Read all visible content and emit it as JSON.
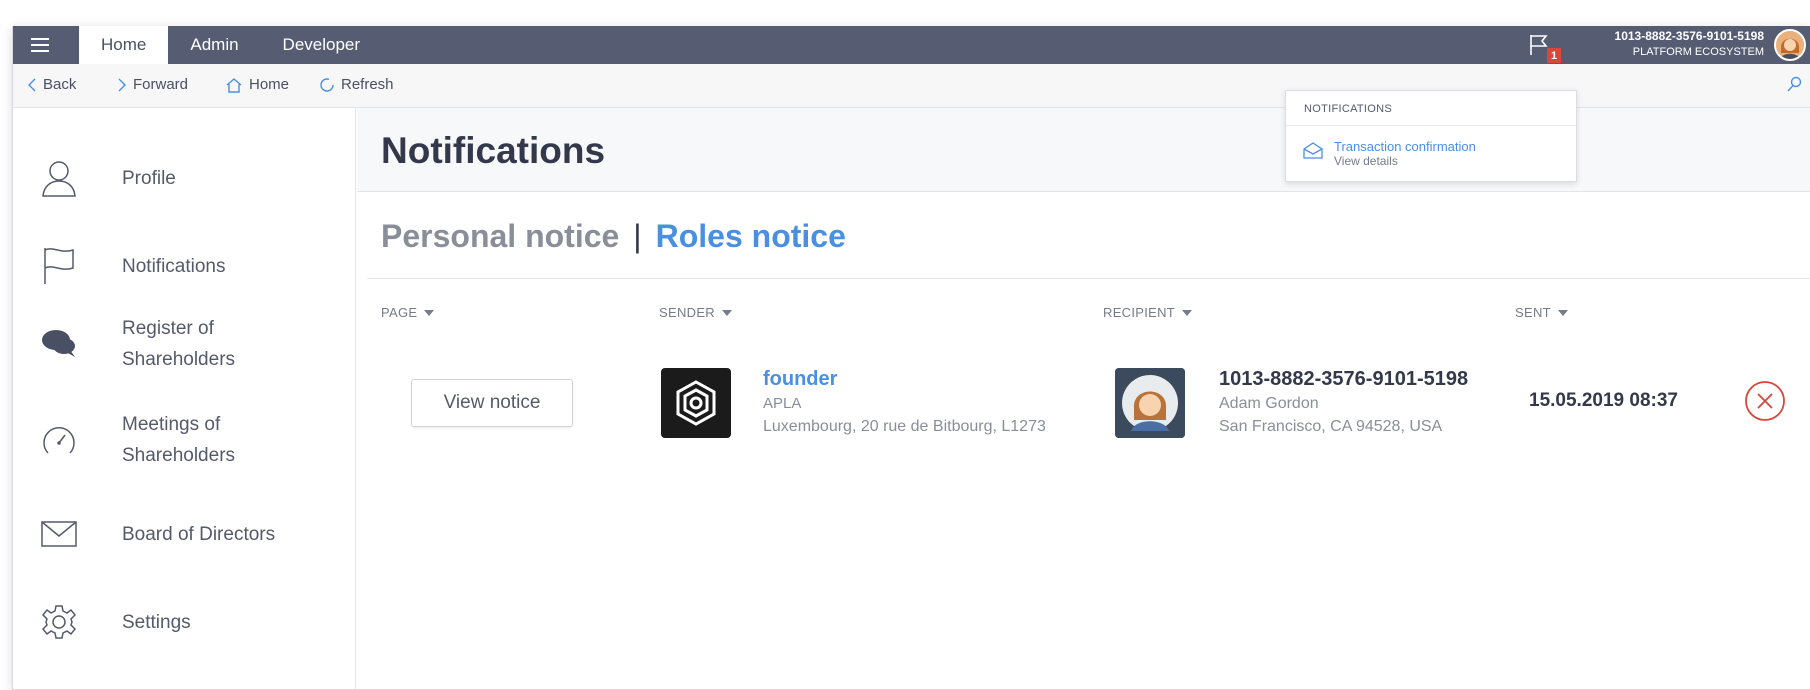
{
  "topbar": {
    "tabs": [
      "Home",
      "Admin",
      "Developer"
    ],
    "notification_count": "1",
    "account_id": "1013-8882-3576-9101-5198",
    "ecosystem": "PLATFORM ECOSYSTEM"
  },
  "navbar": {
    "back": "Back",
    "forward": "Forward",
    "home": "Home",
    "refresh": "Refresh"
  },
  "sidebar": {
    "items": [
      {
        "label": "Profile",
        "icon": "user-icon"
      },
      {
        "label": "Notifications",
        "icon": "flag-icon"
      },
      {
        "label": "Register of Shareholders",
        "icon": "chat-icon"
      },
      {
        "label": "Meetings of Shareholders",
        "icon": "gauge-icon"
      },
      {
        "label": "Board of Directors",
        "icon": "envelope-icon"
      },
      {
        "label": "Settings",
        "icon": "gear-icon"
      }
    ]
  },
  "main": {
    "title": "Notifications",
    "subtab_personal": "Personal notice",
    "subtab_separator": "|",
    "subtab_roles": "Roles notice",
    "columns": {
      "page": "PAGE",
      "sender": "SENDER",
      "recipient": "RECIPIENT",
      "sent": "SENT"
    },
    "row": {
      "view_button": "View notice",
      "sender_name": "founder",
      "sender_org": "APLA",
      "sender_address": "Luxembourg, 20 rue de Bitbourg, L1273",
      "recipient_id": "1013-8882-3576-9101-5198",
      "recipient_name": "Adam Gordon",
      "recipient_address": "San Francisco, CA 94528, USA",
      "sent": "15.05.2019 08:37"
    }
  },
  "dropdown": {
    "header": "NOTIFICATIONS",
    "item_title": "Transaction confirmation",
    "item_subtitle": "View details"
  },
  "colors": {
    "topbar": "#565d73",
    "accent": "#4a90e2",
    "danger": "#d9463b"
  }
}
